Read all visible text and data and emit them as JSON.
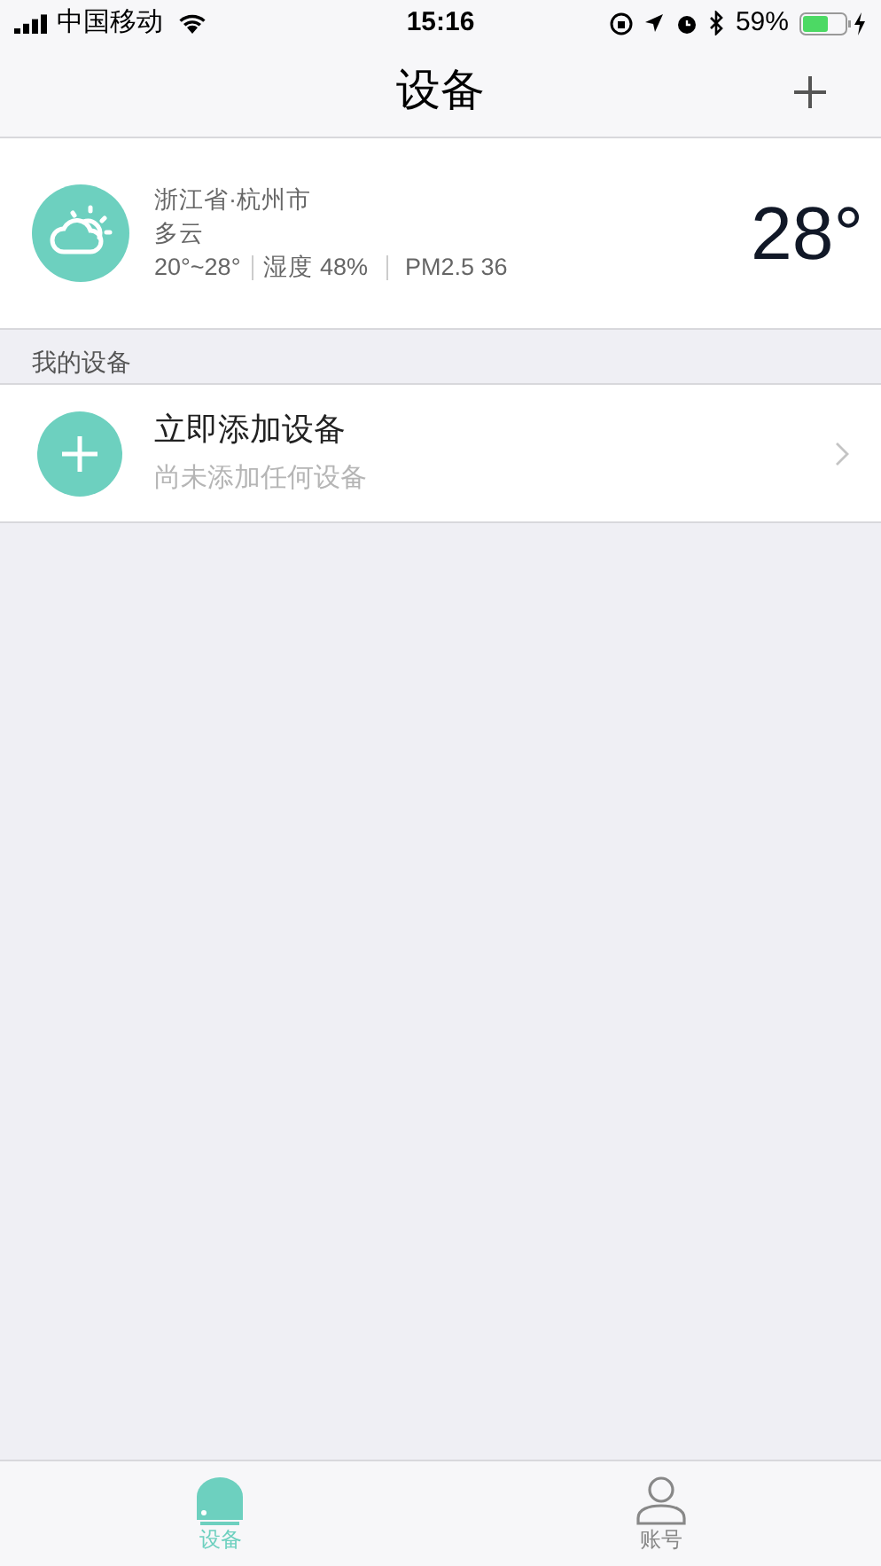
{
  "status_bar": {
    "carrier": "中国移动",
    "time": "15:16",
    "battery": "59%"
  },
  "nav": {
    "title": "设备"
  },
  "weather": {
    "location": "浙江省·杭州市",
    "condition": "多云",
    "range": "20°~28°",
    "humidity": "湿度 48%",
    "pm25": "PM2.5 36",
    "temperature": "28°"
  },
  "section": {
    "title": "我的设备"
  },
  "add_device": {
    "title": "立即添加设备",
    "subtitle": "尚未添加任何设备"
  },
  "tabs": [
    {
      "label": "设备",
      "kind": "device",
      "selected": true
    },
    {
      "label": "账号",
      "kind": "account",
      "selected": false
    }
  ]
}
